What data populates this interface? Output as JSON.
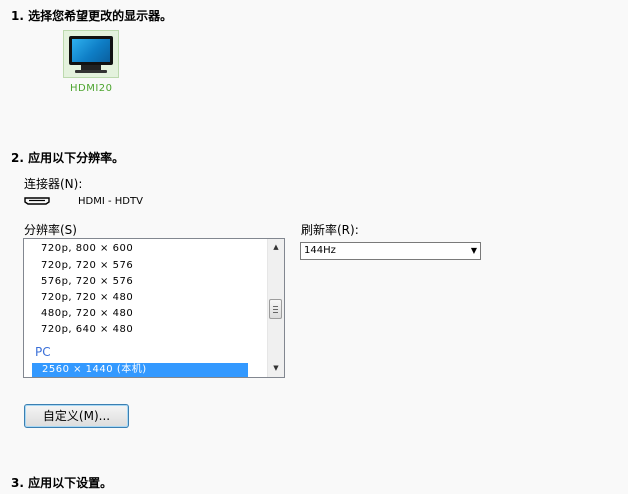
{
  "step1": {
    "title": "1. 选择您希望更改的显示器。"
  },
  "monitor": {
    "name": "HDMI20",
    "icon": "monitor-icon",
    "accent": "#4da52f"
  },
  "step2": {
    "title": "2. 应用以下分辨率。",
    "connector_label": "连接器(N):",
    "connector_value": "HDMI - HDTV",
    "connector_icon": "hdmi-icon",
    "resolution_label": "分辨率(S)",
    "refresh_label": "刷新率(R):"
  },
  "resolution_list": {
    "items": [
      "720p, 800 × 600",
      "720p, 720 × 576",
      "576p, 720 × 576",
      "720p, 720 × 480",
      "480p, 720 × 480",
      "720p, 640 × 480"
    ],
    "group": "PC",
    "selected": "2560 × 1440 (本机)",
    "selection_color": "#3399ff"
  },
  "refresh_select": {
    "value": "144Hz"
  },
  "customize_button": {
    "label": "自定义(M)..."
  },
  "step3": {
    "title": "3. 应用以下设置。"
  }
}
